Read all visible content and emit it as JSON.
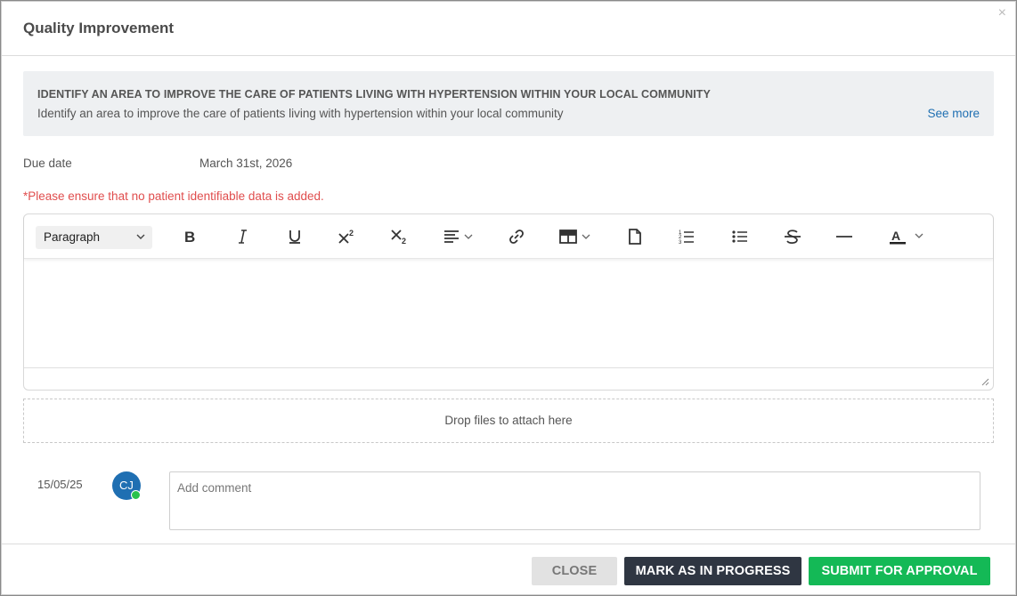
{
  "modal": {
    "title": "Quality Improvement",
    "close_icon": "×"
  },
  "task": {
    "title": "IDENTIFY AN AREA TO IMPROVE THE CARE OF PATIENTS LIVING WITH HYPERTENSION WITHIN YOUR LOCAL COMMUNITY",
    "description": "Identify an area to improve the care of patients living with hypertension within your local community",
    "see_more": "See more"
  },
  "due": {
    "label": "Due date",
    "value": "March 31st, 2026"
  },
  "warning": "*Please ensure that no patient identifiable data is added.",
  "editor": {
    "paragraph_select": "Paragraph",
    "toolbar_icons": [
      "bold-icon",
      "italic-icon",
      "underline-icon",
      "superscript-icon",
      "subscript-icon",
      "align-icon",
      "link-icon",
      "table-icon",
      "document-icon",
      "numbered-list-icon",
      "bulleted-list-icon",
      "strikethrough-icon",
      "horizontal-line-icon",
      "font-color-icon"
    ]
  },
  "dropzone": "Drop files to attach here",
  "comment": {
    "date": "15/05/25",
    "avatar_initials": "CJ",
    "placeholder": "Add comment"
  },
  "footer": {
    "close_label": "CLOSE",
    "progress_label": "MARK AS IN PROGRESS",
    "submit_label": "SUBMIT FOR APPROVAL"
  },
  "colors": {
    "link": "#1f6fb2",
    "warning": "#e04d4d",
    "submit": "#14b956",
    "progress": "#2f3642",
    "presence": "#27c24c"
  }
}
